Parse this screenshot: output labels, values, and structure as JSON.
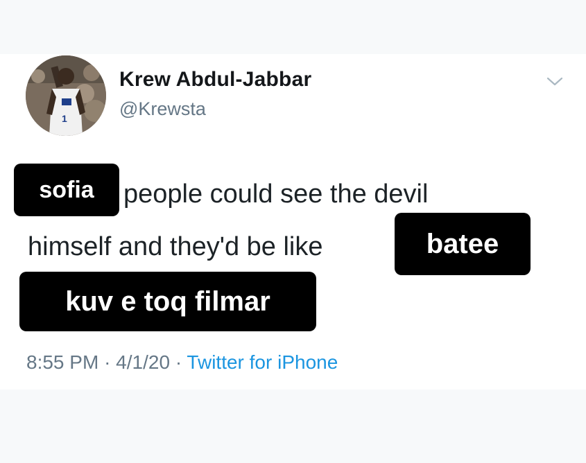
{
  "tweet": {
    "author_name": "Krew Abdul-Jabbar",
    "author_handle": "@Krewsta",
    "segments": {
      "chip_1": "sofia",
      "text_1": "people could see the devil",
      "text_2": "himself and they'd be like",
      "chip_2": "batee",
      "chip_3": "kuv e toq filmar"
    },
    "time": "8:55 PM",
    "separator": "·",
    "date": "4/1/20",
    "source": "Twitter for iPhone"
  },
  "icons": {
    "menu": "chevron-down-icon",
    "avatar": "avatar-photo"
  },
  "colors": {
    "text_primary": "#14171a",
    "text_secondary": "#657786",
    "link": "#1b95e0",
    "chip_bg": "#000000",
    "chip_text": "#ffffff",
    "background": "#f7f9fa",
    "card": "#ffffff"
  }
}
